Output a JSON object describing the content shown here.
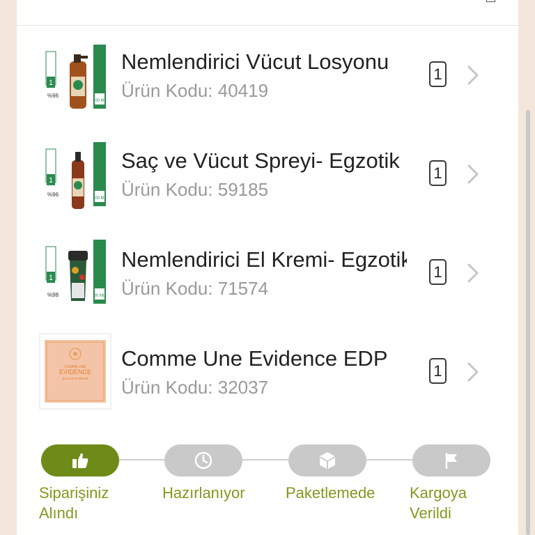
{
  "order_items": [
    {
      "name": "Nemlendirici Vücut Losyonu",
      "code_label": "Ürün Kodu:",
      "code": "40419",
      "quantity": "1",
      "thumbnail": "lotion-bottle-product-image"
    },
    {
      "name": "Saç ve Vücut Spreyi- Egzotik",
      "code_label": "Ürün Kodu:",
      "code": "59185",
      "quantity": "1",
      "thumbnail": "spray-bottle-product-image"
    },
    {
      "name": "Nemlendirici El Kremi- Egzotik",
      "code_label": "Ürün Kodu:",
      "code": "71574",
      "quantity": "1",
      "thumbnail": "hand-cream-product-image"
    },
    {
      "name": "Comme Une Evidence EDP",
      "code_label": "Ürün Kodu:",
      "code": "32037",
      "quantity": "1",
      "thumbnail": "perfume-box-product-image"
    }
  ],
  "product_box_text": {
    "item_1": {
      "percent": "%96",
      "size": "100 ML"
    },
    "item_2": {
      "percent": "%96",
      "size": "100 ML"
    },
    "item_3": {
      "percent": "%98",
      "size": "30 ML"
    },
    "item_4": {
      "brand": "COMME UNE",
      "title": "EVIDENCE",
      "sub": "EAU DE PARFUM"
    }
  },
  "order_status": {
    "steps": [
      {
        "label": "Siparişiniz\nAlındı",
        "icon": "thumbs-up-icon",
        "active": true
      },
      {
        "label": "Hazırlanıyor",
        "icon": "clock-icon",
        "active": false
      },
      {
        "label": "Paketlemede",
        "icon": "box-icon",
        "active": false
      },
      {
        "label": "Kargoya\nVerildi",
        "icon": "flag-icon",
        "active": false
      }
    ]
  },
  "colors": {
    "background": "#f3e7dc",
    "card": "#ffffff",
    "active_step": "#6e8a19",
    "inactive_step": "#c9c9c9",
    "step_label": "#7f9a1d",
    "product_green": "#2a8a4e"
  }
}
